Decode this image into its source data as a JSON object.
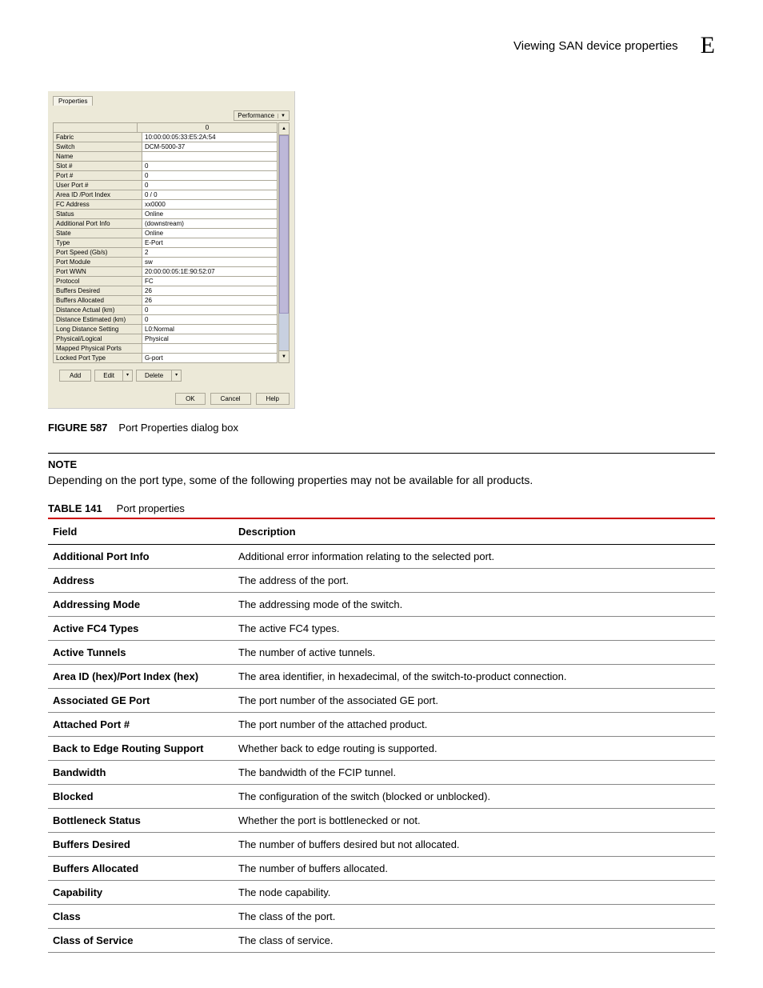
{
  "header": {
    "title": "Viewing SAN device properties",
    "letter": "E"
  },
  "dialog": {
    "tab": "Properties",
    "perf_button": "Performance",
    "head_val": "0",
    "rows": [
      {
        "label": "Fabric",
        "val": "10:00:00:05:33:E5:2A:54"
      },
      {
        "label": "Switch",
        "val": "DCM-5000-37"
      },
      {
        "label": "Name",
        "val": ""
      },
      {
        "label": "Slot #",
        "val": "0"
      },
      {
        "label": "Port #",
        "val": "0"
      },
      {
        "label": "User Port #",
        "val": "0"
      },
      {
        "label": "Area ID /Port Index",
        "val": "0 / 0"
      },
      {
        "label": "FC Address",
        "val": "xx0000"
      },
      {
        "label": "Status",
        "val": "Online"
      },
      {
        "label": "Additional Port Info",
        "val": "(downstream)"
      },
      {
        "label": "State",
        "val": "Online"
      },
      {
        "label": "Type",
        "val": "E-Port"
      },
      {
        "label": "Port Speed (Gb/s)",
        "val": "2"
      },
      {
        "label": "Port Module",
        "val": "sw"
      },
      {
        "label": "Port WWN",
        "val": "20:00:00:05:1E:90:52:07"
      },
      {
        "label": "Protocol",
        "val": "FC"
      },
      {
        "label": "Buffers Desired",
        "val": "26"
      },
      {
        "label": "Buffers Allocated",
        "val": "26"
      },
      {
        "label": "Distance Actual (km)",
        "val": "0"
      },
      {
        "label": "Distance Estimated (km)",
        "val": "0"
      },
      {
        "label": "Long Distance Setting",
        "val": "L0:Normal"
      },
      {
        "label": "Physical/Logical",
        "val": "Physical"
      },
      {
        "label": "Mapped Physical Ports",
        "val": ""
      },
      {
        "label": "Locked Port Type",
        "val": "G-port"
      }
    ],
    "buttons": {
      "add": "Add",
      "edit": "Edit",
      "delete": "Delete",
      "ok": "OK",
      "cancel": "Cancel",
      "help": "Help"
    }
  },
  "figure": {
    "number": "FIGURE 587",
    "caption": "Port Properties dialog box"
  },
  "note": {
    "label": "NOTE",
    "text": "Depending on the port type, some of the following properties may not be available for all products."
  },
  "table_caption": {
    "number": "TABLE 141",
    "title": "Port properties"
  },
  "table": {
    "headers": {
      "field": "Field",
      "desc": "Description"
    },
    "rows": [
      {
        "field": "Additional Port Info",
        "desc": "Additional error information relating to the selected port."
      },
      {
        "field": "Address",
        "desc": "The address of the port."
      },
      {
        "field": "Addressing Mode",
        "desc": "The addressing mode of the switch."
      },
      {
        "field": "Active FC4 Types",
        "desc": "The active FC4 types."
      },
      {
        "field": "Active Tunnels",
        "desc": "The number of active tunnels."
      },
      {
        "field": "Area ID (hex)/Port Index (hex)",
        "desc": "The area identifier, in hexadecimal, of the switch-to-product connection."
      },
      {
        "field": "Associated GE Port",
        "desc": "The port number of the associated GE port."
      },
      {
        "field": "Attached Port #",
        "desc": "The port number of the attached product."
      },
      {
        "field": "Back to Edge Routing Support",
        "desc": "Whether back to edge routing is supported."
      },
      {
        "field": "Bandwidth",
        "desc": "The bandwidth of the FCIP tunnel."
      },
      {
        "field": "Blocked",
        "desc": "The configuration of the switch (blocked or unblocked)."
      },
      {
        "field": "Bottleneck Status",
        "desc": "Whether the port is bottlenecked or not."
      },
      {
        "field": "Buffers Desired",
        "desc": "The number of buffers desired but not allocated."
      },
      {
        "field": "Buffers Allocated",
        "desc": "The number of buffers allocated."
      },
      {
        "field": "Capability",
        "desc": "The node capability."
      },
      {
        "field": "Class",
        "desc": "The class of the port."
      },
      {
        "field": "Class of Service",
        "desc": "The class of service."
      }
    ]
  }
}
